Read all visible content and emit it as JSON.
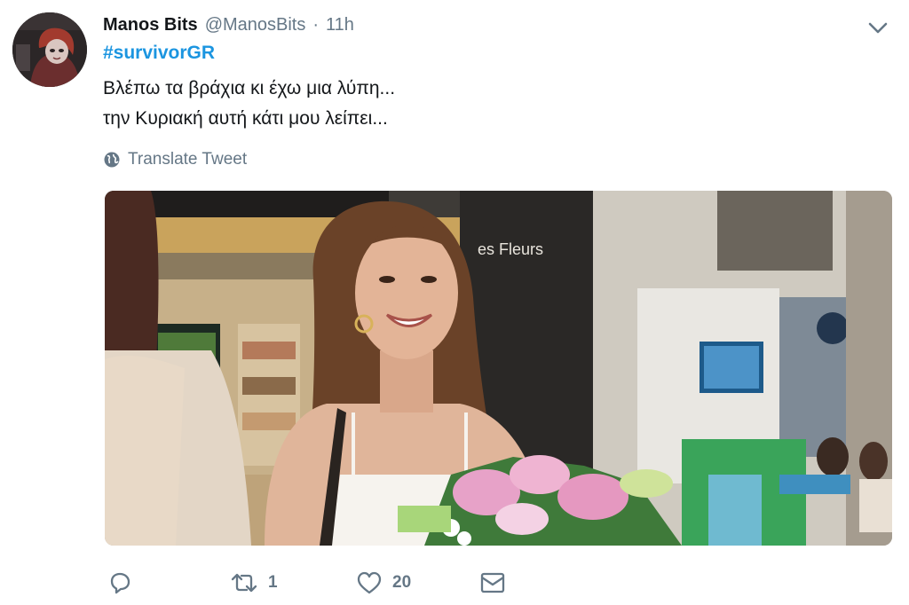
{
  "tweet": {
    "display_name": "Manos Bits",
    "handle": "@ManosBits",
    "separator": "·",
    "time": "11h",
    "hashtag": "#survivorGR",
    "lines": [
      "Βλέπω τα βράχια κι έχω μια λύπη...",
      "την Κυριακή αυτή κάτι μου λείπει..."
    ],
    "translate_label": "Translate Tweet",
    "photo_sign_text": "es Fleurs",
    "retweet_count": "1",
    "like_count": "20"
  },
  "icons": {
    "menu": "chevron-down-icon",
    "translate": "globe-icon",
    "reply": "reply-icon",
    "retweet": "retweet-icon",
    "like": "heart-icon",
    "message": "envelope-icon"
  },
  "colors": {
    "link": "#1b95e0",
    "secondary_text": "#657786",
    "primary_text": "#14171a"
  }
}
